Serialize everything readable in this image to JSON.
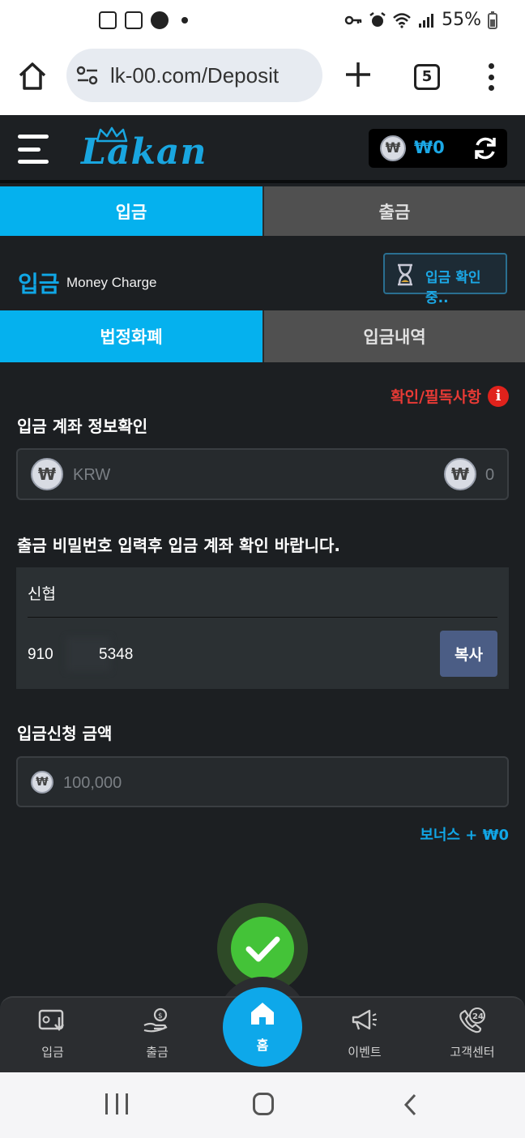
{
  "status_bar": {
    "battery": "55%"
  },
  "browser": {
    "url": "lk-00.com/Deposit",
    "tab_count": "5"
  },
  "header": {
    "logo": "Lakan",
    "wallet_amount": "₩0",
    "won_symbol": "₩"
  },
  "top_tabs": [
    {
      "label": "입금"
    },
    {
      "label": "출금"
    }
  ],
  "title": {
    "main": "입금",
    "sub": "Money Charge",
    "confirm_button": "입금 확인 중.."
  },
  "sub_tabs": [
    {
      "label": "법정화폐"
    },
    {
      "label": "입금내역"
    }
  ],
  "notice": {
    "text": "확인/필독사항",
    "icon_glyph": "i"
  },
  "account_info": {
    "label": "입금 계좌 정보확인",
    "currency": "KRW",
    "balance": "0"
  },
  "bank": {
    "instruction": "출금 비밀번호 입력후 입금 계좌 확인 바랍니다.",
    "name": "신협",
    "account_start": "910",
    "account_end": "5348",
    "copy_label": "복사"
  },
  "amount": {
    "label": "입금신청 금액",
    "placeholder": "100,000"
  },
  "bonus": {
    "text": "보너스 + ₩0"
  },
  "bottom_nav": [
    {
      "label": "입금",
      "icon": "deposit-icon"
    },
    {
      "label": "출금",
      "icon": "withdraw-icon"
    },
    {
      "label": "홈",
      "icon": "home-icon"
    },
    {
      "label": "이벤트",
      "icon": "megaphone-icon"
    },
    {
      "label": "고객센터",
      "icon": "support-24-icon"
    }
  ],
  "colors": {
    "accent": "#05b1ee",
    "notice": "#e73a35",
    "submit": "#44c338"
  }
}
